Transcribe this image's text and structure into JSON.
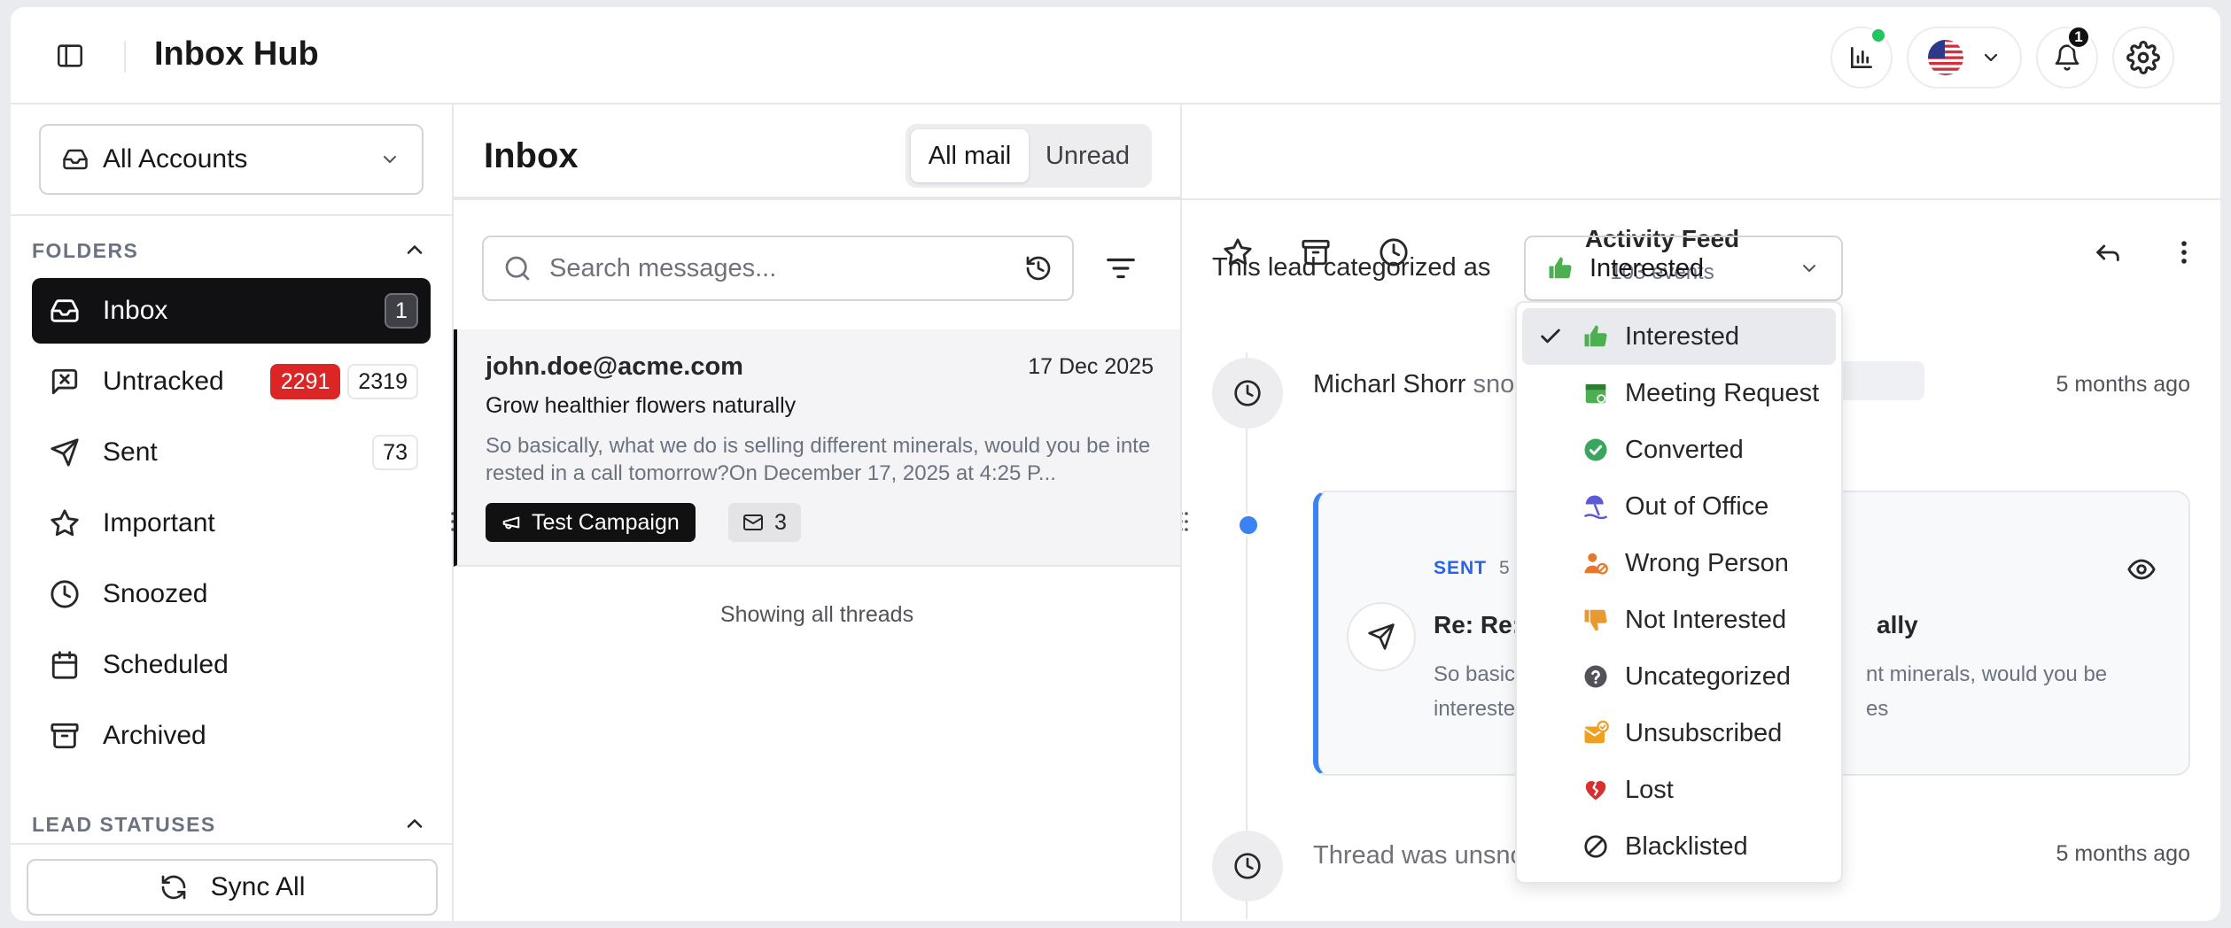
{
  "header": {
    "app_title": "Inbox Hub",
    "notification_count": "1"
  },
  "sidebar": {
    "account_select": "All Accounts",
    "folders_heading": "FOLDERS",
    "folders": [
      {
        "label": "Inbox",
        "count": "1"
      },
      {
        "label": "Untracked",
        "count_unread": "2291",
        "count": "2319"
      },
      {
        "label": "Sent",
        "count": "73"
      },
      {
        "label": "Important"
      },
      {
        "label": "Snoozed"
      },
      {
        "label": "Scheduled"
      },
      {
        "label": "Archived"
      }
    ],
    "lead_statuses_heading": "LEAD STATUSES",
    "sync_label": "Sync All"
  },
  "inbox": {
    "title": "Inbox",
    "filter_tabs": [
      "All mail",
      "Unread"
    ],
    "search_placeholder": "Search messages...",
    "thread": {
      "from": "john.doe@acme.com",
      "date": "17 Dec 2025",
      "subject": "Grow healthier flowers naturally",
      "preview": "So basically, what we do is selling different minerals, would you be interested in a call tomorrow?On December 17, 2025 at 4:25 P...",
      "campaign_tag": "Test Campaign",
      "message_count": "3"
    },
    "footer_text": "Showing all threads"
  },
  "activity": {
    "title": "Activity Feed",
    "subtitle": "103 events",
    "category_label": "This lead categorized as",
    "category_value": "Interested",
    "events": [
      {
        "actor": "Micharl Shorr",
        "action": "sno",
        "time": "5 months ago"
      },
      {
        "action": "Thread was unsno",
        "time": "5 months ago"
      }
    ],
    "card": {
      "status": "SENT",
      "time": "5 r",
      "subject_start": "Re: Re:",
      "subject_end": "ally",
      "body_line1_start": "So basic",
      "body_line1_end": "nt minerals, would you be",
      "body_line2_start": "intereste",
      "body_line2_end": "es"
    }
  },
  "category_options": [
    {
      "label": "Interested",
      "icon": "thumbs-up-icon",
      "color": "#4caf50",
      "selected": true
    },
    {
      "label": "Meeting Request",
      "icon": "calendar-icon",
      "color": "#4caf50"
    },
    {
      "label": "Converted",
      "icon": "check-circle-icon",
      "color": "#3aa55d"
    },
    {
      "label": "Out of Office",
      "icon": "beach-icon",
      "color": "#5b5bd6"
    },
    {
      "label": "Wrong Person",
      "icon": "person-block-icon",
      "color": "#e8772e"
    },
    {
      "label": "Not Interested",
      "icon": "thumbs-down-icon",
      "color": "#e89a2e"
    },
    {
      "label": "Uncategorized",
      "icon": "question-icon",
      "color": "#52525b"
    },
    {
      "label": "Unsubscribed",
      "icon": "mail-unsubscribe-icon",
      "color": "#f0a020"
    },
    {
      "label": "Lost",
      "icon": "broken-heart-icon",
      "color": "#d63031"
    },
    {
      "label": "Blacklisted",
      "icon": "ban-icon",
      "color": "#27272a"
    }
  ]
}
